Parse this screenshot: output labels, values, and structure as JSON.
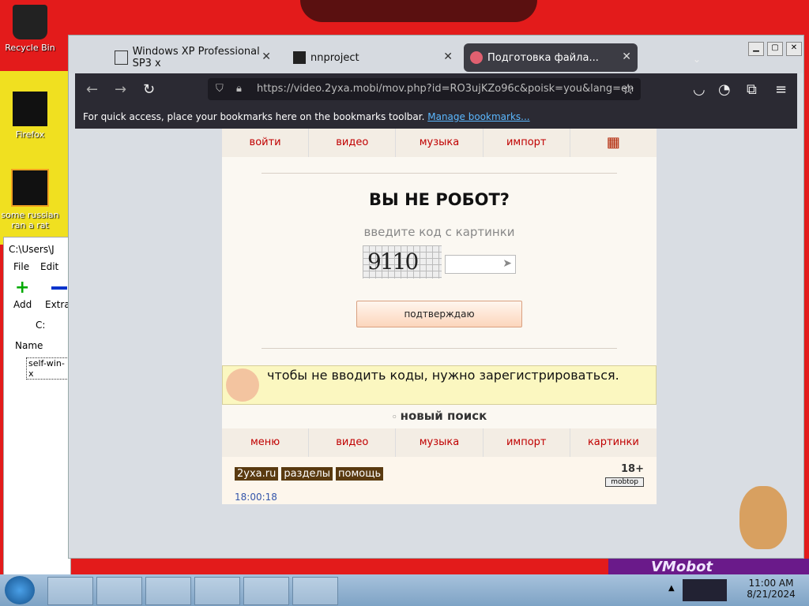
{
  "desktop": {
    "icons": [
      {
        "label": "Recycle Bin"
      },
      {
        "label": "Firefox"
      },
      {
        "label": "some russian ran a rat"
      }
    ]
  },
  "browser": {
    "tabs": [
      {
        "label": "Windows XP Professional SP3 x"
      },
      {
        "label": "nnproject"
      },
      {
        "label": "Подготовка файла..."
      }
    ],
    "url": "https://video.2yxa.mobi/mov.php?id=RO3ujKZo96c&poisk=you&lang=en",
    "bookmarks_text": "For quick access, place your bookmarks here on the bookmarks toolbar.",
    "bookmarks_link": "Manage bookmarks..."
  },
  "page": {
    "top_menu": [
      "войти",
      "видео",
      "музыка",
      "импорт"
    ],
    "title": "ВЫ НЕ РОБОТ?",
    "subtitle": "введите код с картинки",
    "captcha_code": "9110",
    "confirm_label": "подтверждаю",
    "notice": "чтобы не вводить коды, нужно зарегистрироваться.",
    "new_search": "новый поиск",
    "bottom_menu": [
      "меню",
      "видео",
      "музыка",
      "импорт",
      "картинки"
    ],
    "footer_tags": [
      "2yxa.ru",
      "разделы",
      "помощь"
    ],
    "age": "18+",
    "counter": "mobtop",
    "time": "18:00:18"
  },
  "zip": {
    "title": "C:\\Users\\J",
    "menu": [
      "File",
      "Edit"
    ],
    "tools": [
      "Add",
      "Extrac"
    ],
    "path": "C:",
    "column": "Name",
    "file": "self-win-x"
  },
  "taskbar": {
    "time": "11:00 AM",
    "date": "8/21/2024"
  },
  "overlay": {
    "vmobot": "VMobot"
  }
}
